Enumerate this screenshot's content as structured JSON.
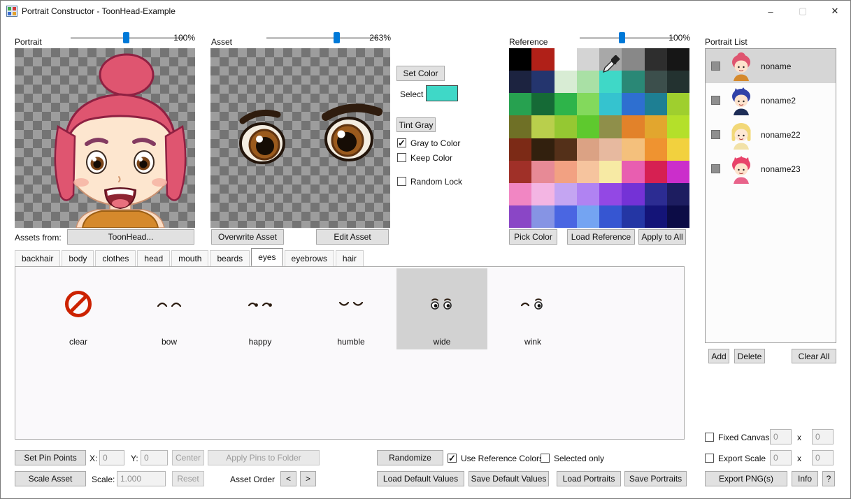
{
  "window": {
    "title": "Portrait Constructor - ToonHead-Example",
    "minimize": "–",
    "maximize": "▢",
    "close": "✕"
  },
  "portrait_panel": {
    "label": "Portrait",
    "zoom": "100%",
    "assets_from_label": "Assets from:",
    "assets_from_button": "ToonHead..."
  },
  "asset_panel": {
    "label": "Asset",
    "zoom": "263%",
    "overwrite_button": "Overwrite Asset",
    "edit_button": "Edit Asset"
  },
  "color_controls": {
    "set_color_button": "Set Color",
    "select_label": "Select",
    "selected_color": "#3fd8c7",
    "tint_gray_button": "Tint Gray",
    "gray_to_color": {
      "label": "Gray to Color",
      "checked": true
    },
    "keep_color": {
      "label": "Keep Color",
      "checked": false
    },
    "random_lock": {
      "label": "Random Lock",
      "checked": false
    }
  },
  "reference_panel": {
    "label": "Reference",
    "zoom": "100%",
    "pick_color_button": "Pick Color",
    "load_reference_button": "Load Reference",
    "apply_to_all_button": "Apply to All",
    "palette": [
      "#000000",
      "#b02018",
      "#ffffff",
      "#d4d4d4",
      "#a8a8a8",
      "#888888",
      "#2e2e2e",
      "#161616",
      "#1c2340",
      "#24356e",
      "#d8ecd4",
      "#a9e0a5",
      "#3fd8c7",
      "#2a8876",
      "#3c4f4c",
      "#233230",
      "#27a150",
      "#156a36",
      "#2eb44a",
      "#83d95c",
      "#35c3cf",
      "#2e6fd0",
      "#1e7f93",
      "#9fcf2e",
      "#6f7026",
      "#b9cf4c",
      "#95c832",
      "#5ec92e",
      "#8f8f4a",
      "#e2822a",
      "#e2a62e",
      "#b4e02a",
      "#7c2a16",
      "#32200e",
      "#543019",
      "#dba284",
      "#e7b99f",
      "#f4c07c",
      "#ef9330",
      "#f2d13e",
      "#a03028",
      "#e78a96",
      "#f2a182",
      "#f6c49e",
      "#f7eaa4",
      "#e85eb0",
      "#d62052",
      "#cb2ecb",
      "#f186c3",
      "#f3b5e3",
      "#c4a5f2",
      "#b083f2",
      "#9348e4",
      "#7432d6",
      "#2c2c92",
      "#1d1d60",
      "#8a46c6",
      "#8694e4",
      "#4a66e2",
      "#74a4f2",
      "#3656d2",
      "#2436a4",
      "#141478",
      "#0c0c46"
    ]
  },
  "portrait_list": {
    "label": "Portrait List",
    "add_button": "Add",
    "delete_button": "Delete",
    "clear_all_button": "Clear All",
    "items": [
      {
        "name": "noname",
        "selected": true,
        "hair": "#df5570",
        "skin": "#fde3cd",
        "shirt": "#d5892c"
      },
      {
        "name": "noname2",
        "selected": false,
        "hair": "#3142a8",
        "skin": "#fde3cd",
        "shirt": "#1d2d56"
      },
      {
        "name": "noname22",
        "selected": false,
        "hair": "#f2d878",
        "skin": "#fde8d4",
        "shirt": "#f2e2a8"
      },
      {
        "name": "noname23",
        "selected": false,
        "hair": "#e8436a",
        "skin": "#fde3cd",
        "shirt": "#e8638a"
      }
    ]
  },
  "tabs": {
    "items": [
      {
        "label": "backhair",
        "selected": false
      },
      {
        "label": "body",
        "selected": false
      },
      {
        "label": "clothes",
        "selected": false
      },
      {
        "label": "head",
        "selected": false
      },
      {
        "label": "mouth",
        "selected": false
      },
      {
        "label": "beards",
        "selected": false
      },
      {
        "label": "eyes",
        "selected": true
      },
      {
        "label": "eyebrows",
        "selected": false
      },
      {
        "label": "hair",
        "selected": false
      }
    ]
  },
  "asset_grid": {
    "items": [
      {
        "label": "clear",
        "selected": false
      },
      {
        "label": "bow",
        "selected": false
      },
      {
        "label": "happy",
        "selected": false
      },
      {
        "label": "humble",
        "selected": false
      },
      {
        "label": "wide",
        "selected": true
      },
      {
        "label": "wink",
        "selected": false
      }
    ]
  },
  "pin_controls": {
    "set_pin_points_button": "Set Pin Points",
    "x_label": "X:",
    "x_value": "0",
    "y_label": "Y:",
    "y_value": "0",
    "center_button": "Center",
    "apply_pins_button": "Apply Pins to Folder",
    "scale_asset_button": "Scale Asset",
    "scale_label": "Scale:",
    "scale_value": "1.000",
    "reset_button": "Reset",
    "asset_order_label": "Asset Order",
    "order_prev_button": "<",
    "order_next_button": ">"
  },
  "actions": {
    "randomize_button": "Randomize",
    "use_reference_colors": {
      "label": "Use Reference Colors",
      "checked": true
    },
    "selected_only": {
      "label": "Selected only",
      "checked": false
    },
    "load_default_values_button": "Load Default Values",
    "save_default_values_button": "Save Default Values",
    "load_portraits_button": "Load Portraits",
    "save_portraits_button": "Save Portraits"
  },
  "export": {
    "fixed_canvas": {
      "label": "Fixed Canvas",
      "checked": false,
      "width": "0",
      "height": "0"
    },
    "export_scale": {
      "label": "Export Scale",
      "checked": false,
      "width": "0",
      "height": "0"
    },
    "x_separator": "x",
    "export_png_button": "Export PNG(s)",
    "info_button": "Info",
    "help_button": "?"
  }
}
